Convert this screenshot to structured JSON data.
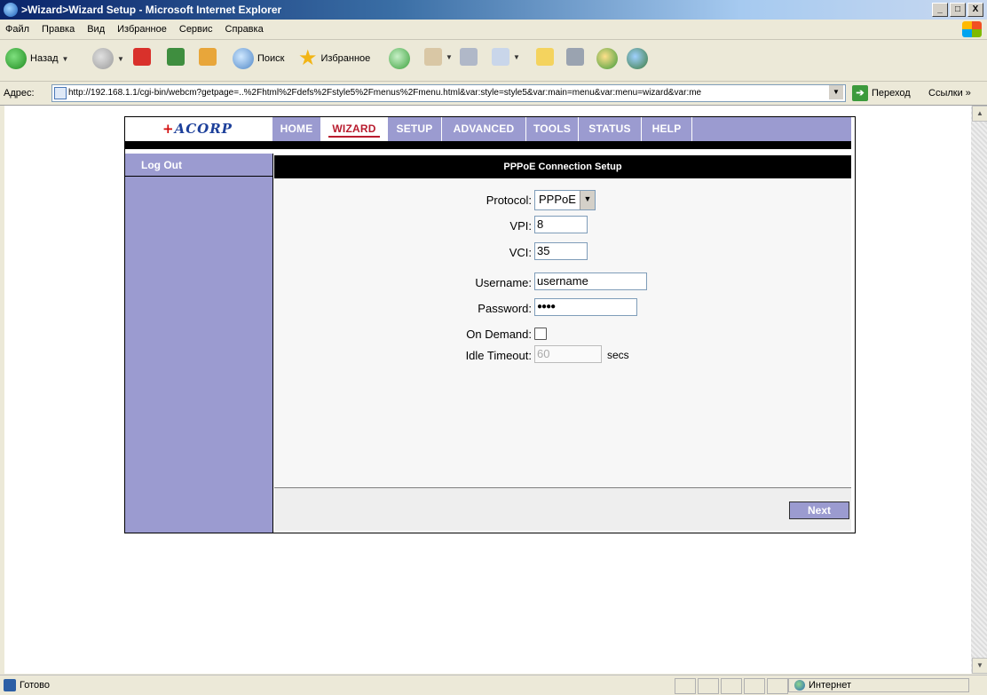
{
  "window": {
    "title": ">Wizard>Wizard Setup - Microsoft Internet Explorer",
    "btn_min": "_",
    "btn_max": "□",
    "btn_close": "X"
  },
  "menubar": {
    "items": [
      "Файл",
      "Правка",
      "Вид",
      "Избранное",
      "Сервис",
      "Справка"
    ]
  },
  "toolbar": {
    "back": "Назад",
    "search": "Поиск",
    "favorites": "Избранное"
  },
  "address": {
    "label": "Адрес:",
    "url": "http://192.168.1.1/cgi-bin/webcm?getpage=..%2Fhtml%2Fdefs%2Fstyle5%2Fmenus%2Fmenu.html&var:style=style5&var:main=menu&var:menu=wizard&var:me",
    "go": "Переход",
    "links": "Ссылки »"
  },
  "router": {
    "logo": "ACORP",
    "nav": [
      "HOME",
      "WIZARD",
      "SETUP",
      "ADVANCED",
      "TOOLS",
      "STATUS",
      "HELP"
    ],
    "active_nav": "WIZARD",
    "sidebar": {
      "logout": "Log Out"
    },
    "panel": {
      "title": "PPPoE Connection Setup",
      "protocol": {
        "label": "Protocol:",
        "value": "PPPoE"
      },
      "vpi": {
        "label": "VPI:",
        "value": "8"
      },
      "vci": {
        "label": "VCI:",
        "value": "35"
      },
      "username": {
        "label": "Username:",
        "value": "username"
      },
      "password": {
        "label": "Password:",
        "value": "●●●●"
      },
      "on_demand": {
        "label": "On Demand:",
        "checked": false
      },
      "idle_timeout": {
        "label": "Idle Timeout:",
        "value": "60",
        "unit": "secs"
      },
      "next": "Next"
    }
  },
  "status": {
    "ready": "Готово",
    "zone": "Интернет"
  }
}
